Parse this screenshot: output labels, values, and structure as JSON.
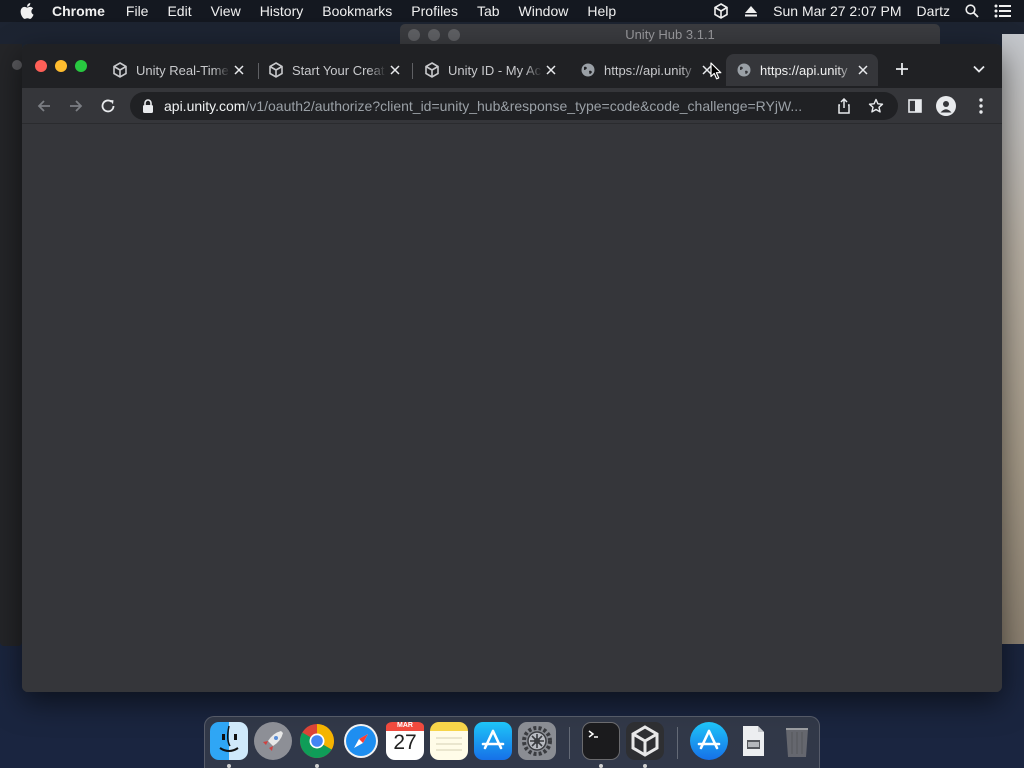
{
  "menubar": {
    "app_name": "Chrome",
    "menus": [
      "File",
      "Edit",
      "View",
      "History",
      "Bookmarks",
      "Profiles",
      "Tab",
      "Window",
      "Help"
    ],
    "clock": "Sun Mar 27  2:07 PM",
    "user": "Dartz"
  },
  "background_window": {
    "title": "Unity Hub 3.1.1"
  },
  "browser": {
    "tabs": [
      {
        "label": "Unity Real-Time",
        "icon": "unity-icon",
        "active": false
      },
      {
        "label": "Start Your Creat",
        "icon": "unity-icon",
        "active": false
      },
      {
        "label": "Unity ID - My Ac",
        "icon": "unity-icon",
        "active": false
      },
      {
        "label": "https://api.unity",
        "icon": "globe-icon",
        "active": false
      },
      {
        "label": "https://api.unity",
        "icon": "globe-icon",
        "active": true
      }
    ],
    "omnibox": {
      "host": "api.unity.com",
      "path": "/v1/oauth2/authorize?client_id=unity_hub&response_type=code&code_challenge=RYjW..."
    }
  },
  "dock": {
    "apps": [
      "Finder",
      "Launchpad",
      "Google Chrome",
      "Safari",
      "Calendar",
      "Notes",
      "App Store",
      "System Preferences",
      "Terminal",
      "Unity Hub",
      "Downloads",
      "Documents",
      "Trash"
    ],
    "calendar": {
      "month": "MAR",
      "day": "27"
    }
  },
  "colors": {
    "titlebar": "#202124",
    "toolbar": "#35363a",
    "omnibox": "#202124",
    "close_red": "#fe5f57",
    "minimize_yellow": "#febc2e",
    "zoom_green": "#28c840"
  }
}
